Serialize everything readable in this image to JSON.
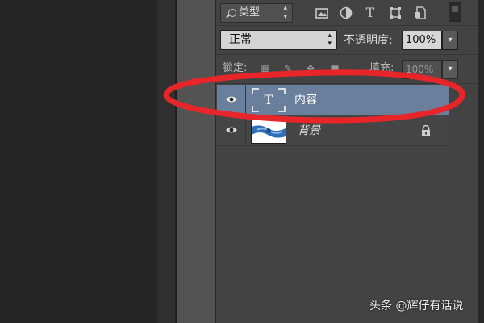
{
  "layers_panel": {
    "filter": {
      "kind_label": "类型",
      "icons": [
        "image-filter-icon",
        "adjustment-filter-icon",
        "type-filter-icon",
        "shape-filter-icon",
        "smart-object-filter-icon"
      ],
      "type_glyph": "T"
    },
    "blend_mode": "正常",
    "opacity_label": "不透明度:",
    "opacity_value": "100%",
    "lock_label": "锁定:",
    "fill_label": "填充:",
    "fill_value": "100%",
    "layers": [
      {
        "name": "内容",
        "type": "text",
        "thumb_glyph": "T",
        "visible": true,
        "selected": true
      },
      {
        "name": "背景",
        "type": "image",
        "visible": true,
        "locked": true,
        "selected": false
      }
    ]
  },
  "annotation": {
    "shape": "ellipse",
    "color": "#e8262a"
  },
  "watermark": "头条 @辉仔有话说",
  "colors": {
    "panel_bg": "#434343",
    "selected_layer_bg": "#6a7f9c",
    "workspace_bg": "#252525"
  }
}
